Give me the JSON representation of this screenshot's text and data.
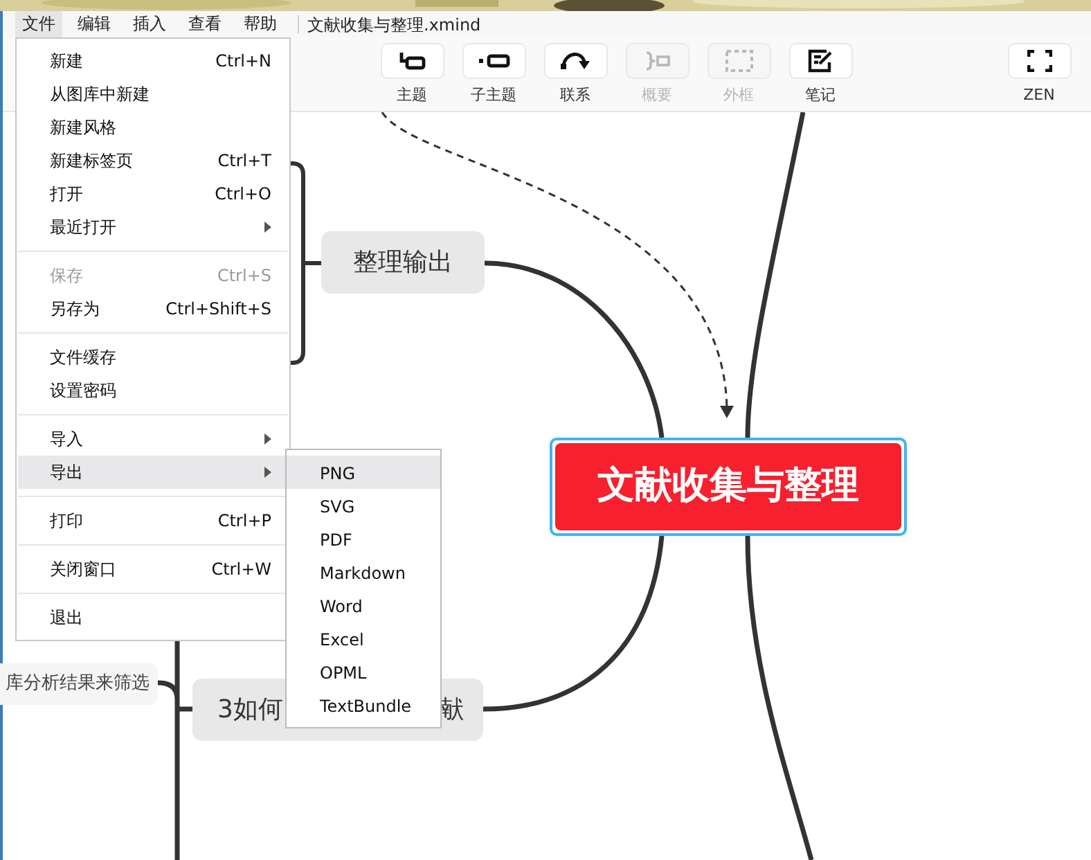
{
  "menubar": {
    "items": [
      {
        "label": "文件",
        "selected": true
      },
      {
        "label": "编辑",
        "selected": false
      },
      {
        "label": "插入",
        "selected": false
      },
      {
        "label": "查看",
        "selected": false
      },
      {
        "label": "帮助",
        "selected": false
      }
    ],
    "document_title": "文献收集与整理.xmind"
  },
  "toolbar": {
    "buttons": [
      {
        "label": "主题",
        "disabled": false
      },
      {
        "label": "子主题",
        "disabled": false
      },
      {
        "label": "联系",
        "disabled": false
      },
      {
        "label": "概要",
        "disabled": true
      },
      {
        "label": "外框",
        "disabled": true
      },
      {
        "label": "笔记",
        "disabled": false
      },
      {
        "label": "ZEN",
        "disabled": false
      }
    ]
  },
  "file_menu": {
    "sections": [
      [
        {
          "label": "新建",
          "shortcut": "Ctrl+N",
          "submenu": false,
          "disabled": false,
          "selected": false
        },
        {
          "label": "从图库中新建",
          "submenu": false,
          "disabled": false,
          "selected": false
        },
        {
          "label": "新建风格",
          "submenu": false,
          "disabled": false,
          "selected": false
        },
        {
          "label": "新建标签页",
          "shortcut": "Ctrl+T",
          "submenu": false,
          "disabled": false,
          "selected": false
        },
        {
          "label": "打开",
          "shortcut": "Ctrl+O",
          "submenu": false,
          "disabled": false,
          "selected": false
        },
        {
          "label": "最近打开",
          "submenu": true,
          "disabled": false,
          "selected": false
        }
      ],
      [
        {
          "label": "保存",
          "shortcut": "Ctrl+S",
          "submenu": false,
          "disabled": true,
          "selected": false
        },
        {
          "label": "另存为",
          "shortcut": "Ctrl+Shift+S",
          "submenu": false,
          "disabled": false,
          "selected": false
        }
      ],
      [
        {
          "label": "文件缓存",
          "submenu": false,
          "disabled": false,
          "selected": false
        },
        {
          "label": "设置密码",
          "submenu": false,
          "disabled": false,
          "selected": false
        }
      ],
      [
        {
          "label": "导入",
          "submenu": true,
          "disabled": false,
          "selected": false
        },
        {
          "label": "导出",
          "submenu": true,
          "disabled": false,
          "selected": true
        }
      ],
      [
        {
          "label": "打印",
          "shortcut": "Ctrl+P",
          "submenu": false,
          "disabled": false,
          "selected": false
        }
      ],
      [
        {
          "label": "关闭窗口",
          "shortcut": "Ctrl+W",
          "submenu": false,
          "disabled": false,
          "selected": false
        }
      ],
      [
        {
          "label": "退出",
          "submenu": false,
          "disabled": false,
          "selected": false
        }
      ]
    ]
  },
  "export_submenu": {
    "items": [
      {
        "label": "PNG",
        "selected": true
      },
      {
        "label": "SVG",
        "selected": false
      },
      {
        "label": "PDF",
        "selected": false
      },
      {
        "label": "Markdown",
        "selected": false
      },
      {
        "label": "Word",
        "selected": false
      },
      {
        "label": "Excel",
        "selected": false
      },
      {
        "label": "OPML",
        "selected": false
      },
      {
        "label": "TextBundle",
        "selected": false
      }
    ]
  },
  "mind_map": {
    "central_topic": "文献收集与整理",
    "topics": [
      {
        "label_parts": [
          "整理输出"
        ]
      },
      {
        "label_parts": [
          "3如何",
          "献"
        ]
      }
    ],
    "subtopic": "库分析结果来筛选"
  }
}
